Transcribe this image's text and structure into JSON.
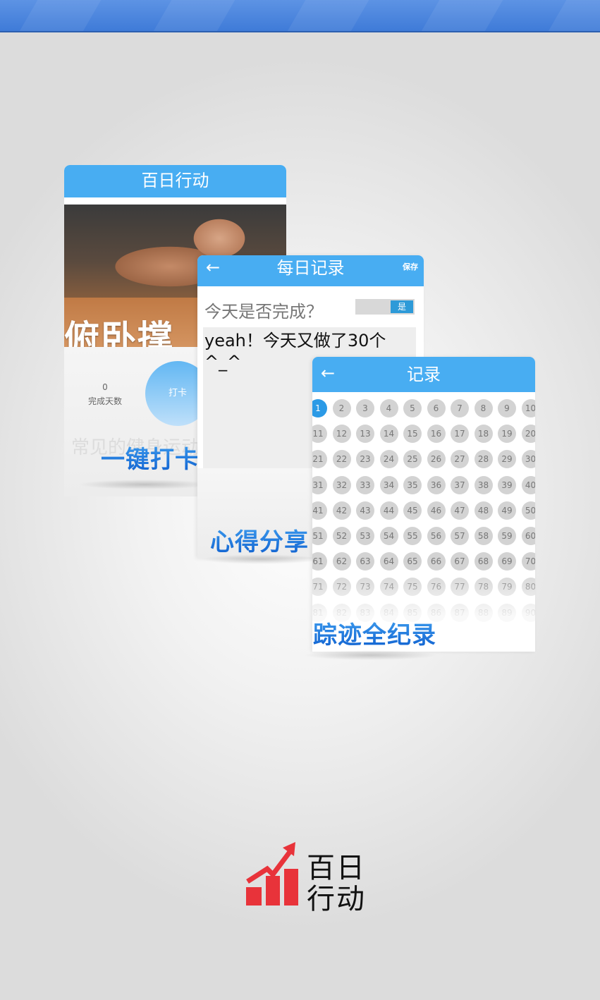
{
  "colors": {
    "header_blue": "#48adf2",
    "accent_blue": "#2b9ae6",
    "caption_blue": "#1a6fd6",
    "logo_red": "#e8333a"
  },
  "card1": {
    "title": "百日行动",
    "exercise": "俯卧撑",
    "count": "0",
    "count_label": "完成天数",
    "checkin_label": "打卡",
    "faint_text": "常见的健身运动"
  },
  "caption1": "一键打卡",
  "card2": {
    "back_icon": "←",
    "title": "每日记录",
    "save_label": "保存",
    "question": "今天是否完成？",
    "toggle_value": "是",
    "note": "yeah！今天又做了30个^_^"
  },
  "caption2": "心得分享",
  "card3": {
    "back_icon": "←",
    "title": "记录",
    "active_day": "1",
    "days": [
      "1",
      "2",
      "3",
      "4",
      "5",
      "6",
      "7",
      "8",
      "9",
      "10",
      "11",
      "12",
      "13",
      "14",
      "15",
      "16",
      "17",
      "18",
      "19",
      "20",
      "21",
      "22",
      "23",
      "24",
      "25",
      "26",
      "27",
      "28",
      "29",
      "30",
      "31",
      "32",
      "33",
      "34",
      "35",
      "36",
      "37",
      "38",
      "39",
      "40",
      "41",
      "42",
      "43",
      "44",
      "45",
      "46",
      "47",
      "48",
      "49",
      "50",
      "51",
      "52",
      "53",
      "54",
      "55",
      "56",
      "57",
      "58",
      "59",
      "60",
      "61",
      "62",
      "63",
      "64",
      "65",
      "66",
      "67",
      "68",
      "69",
      "70",
      "71",
      "72",
      "73",
      "74",
      "75",
      "76",
      "77",
      "78",
      "79",
      "80",
      "81",
      "82",
      "83",
      "84",
      "85",
      "86",
      "87",
      "88",
      "89",
      "90"
    ]
  },
  "caption3": "踪迹全纪录",
  "logo": {
    "line1": "百日",
    "line2": "行动",
    "icon": "rising-bar-chart-icon"
  }
}
